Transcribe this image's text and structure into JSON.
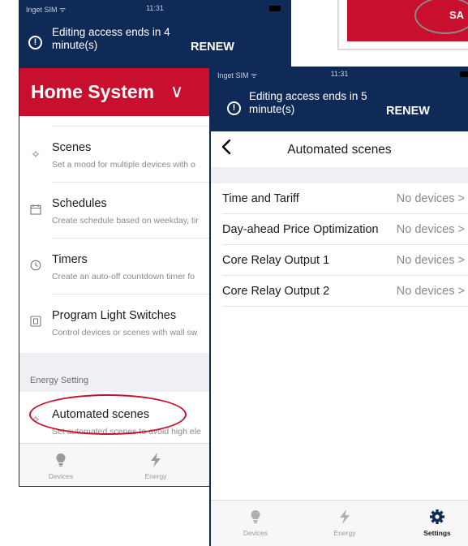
{
  "fragment": {
    "button_text": "SA"
  },
  "phone1": {
    "status": {
      "carrier": "Inget SIM ᯤ",
      "time": "11:31"
    },
    "banner": {
      "message": "Editing access ends in 4 minute(s)",
      "renew": "RENEW"
    },
    "header": {
      "title": "Home System",
      "chevron": "∨"
    },
    "items": [
      {
        "title": "Scenes",
        "subtitle": "Set a mood for multiple devices with o",
        "icon": "sparkle-icon"
      },
      {
        "title": "Schedules",
        "subtitle": "Create schedule based on weekday, tir",
        "icon": "calendar-icon"
      },
      {
        "title": "Timers",
        "subtitle": "Create an auto-off countdown timer fo",
        "icon": "clock-icon"
      },
      {
        "title": "Program Light Switches",
        "subtitle": "Control devices or scenes with wall sw",
        "icon": "switch-icon"
      }
    ],
    "section": "Energy Setting",
    "energy_item": {
      "title": "Automated scenes",
      "subtitle": "Set automated scenes to avoid high ele"
    },
    "tabs": [
      {
        "label": "Devices",
        "icon": "bulb-icon"
      },
      {
        "label": "Energy",
        "icon": "bolt-icon"
      }
    ]
  },
  "phone2": {
    "status": {
      "carrier": "Inget SIM ᯤ",
      "time": "11:31"
    },
    "banner": {
      "message": "Editing access ends in 5 minute(s)",
      "renew": "RENEW"
    },
    "nav": {
      "back": "‹",
      "title": "Automated scenes"
    },
    "rows": [
      {
        "label": "Time and Tariff",
        "value": "No devices >"
      },
      {
        "label": "Day-ahead Price Optimization",
        "value": "No devices >"
      },
      {
        "label": "Core Relay Output 1",
        "value": "No devices >"
      },
      {
        "label": "Core Relay Output 2",
        "value": "No devices >"
      }
    ],
    "tabs": [
      {
        "label": "Devices",
        "icon": "bulb-icon"
      },
      {
        "label": "Energy",
        "icon": "bolt-icon"
      },
      {
        "label": "Settings",
        "icon": "gear-icon",
        "active": true
      }
    ]
  },
  "colors": {
    "navy": "#0f2a57",
    "brand_red": "#c8102e",
    "highlight": "#c8102e"
  }
}
